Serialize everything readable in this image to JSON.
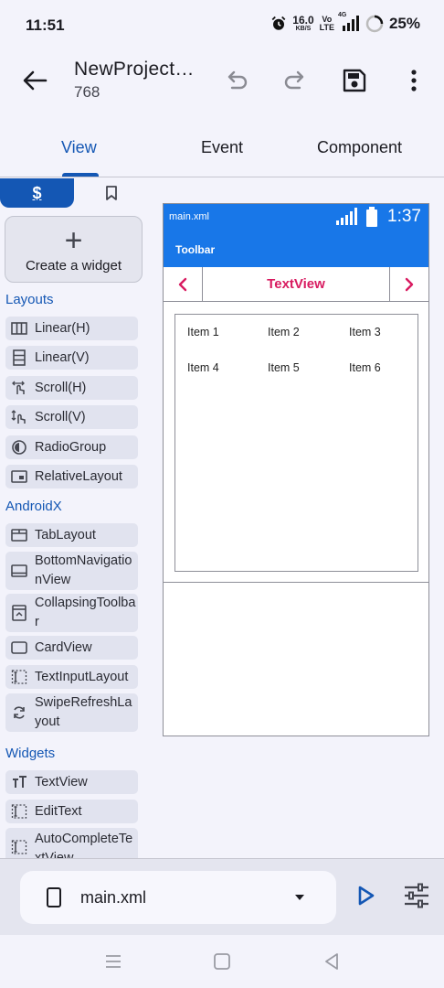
{
  "status_bar": {
    "time": "11:51",
    "speed_value": "16.0",
    "speed_unit": "KB/S",
    "volte_top": "Vo",
    "volte_bottom": "LTE",
    "network": "4G",
    "battery": "25%"
  },
  "app_bar": {
    "title": "NewProject…",
    "subtitle": "768",
    "icons": [
      "back-arrow-icon",
      "undo-icon",
      "redo-icon",
      "save-icon",
      "more-vert-icon"
    ]
  },
  "tabs": [
    {
      "label": "View",
      "active": true
    },
    {
      "label": "Event",
      "active": false
    },
    {
      "label": "Component",
      "active": false
    }
  ],
  "palette": {
    "active_tab_icon": "$",
    "create_widget_label": "Create a widget",
    "sections": {
      "layouts": "Layouts",
      "androidx": "AndroidX",
      "widgets": "Widgets"
    },
    "layouts": [
      {
        "label": "Linear(H)",
        "icon": "columns-icon"
      },
      {
        "label": "Linear(V)",
        "icon": "rows-icon"
      },
      {
        "label": "Scroll(H)",
        "icon": "swipe-horizontal-icon"
      },
      {
        "label": "Scroll(V)",
        "icon": "swipe-vertical-icon"
      },
      {
        "label": "RadioGroup",
        "icon": "radio-icon"
      },
      {
        "label": "RelativeLayout",
        "icon": "relative-layout-icon"
      }
    ],
    "androidx": [
      {
        "label": "TabLayout",
        "icon": "tab-icon"
      },
      {
        "label": "BottomNavigationView",
        "icon": "bottom-nav-icon"
      },
      {
        "label": "CollapsingToolbar",
        "icon": "collapsing-toolbar-icon"
      },
      {
        "label": "CardView",
        "icon": "card-icon"
      },
      {
        "label": "TextInputLayout",
        "icon": "text-input-icon"
      },
      {
        "label": "SwipeRefreshLayout",
        "icon": "refresh-icon"
      }
    ],
    "widgets": [
      {
        "label": "TextView",
        "icon": "text-icon"
      },
      {
        "label": "EditText",
        "icon": "edit-text-icon"
      },
      {
        "label": "AutoCompleteTextView",
        "icon": "autocomplete-icon"
      }
    ]
  },
  "preview": {
    "file": "main.xml",
    "clock": "1:37",
    "toolbar_title": "Toolbar",
    "nav_title": "TextView",
    "grid_items": [
      "Item 1",
      "Item 2",
      "Item 3",
      "Item 4",
      "Item 5",
      "Item 6"
    ]
  },
  "bottom_bar": {
    "file_name": "main.xml"
  },
  "colors": {
    "accent": "#1457b4",
    "preview_primary": "#1877e8",
    "preview_accent": "#d81b60"
  }
}
